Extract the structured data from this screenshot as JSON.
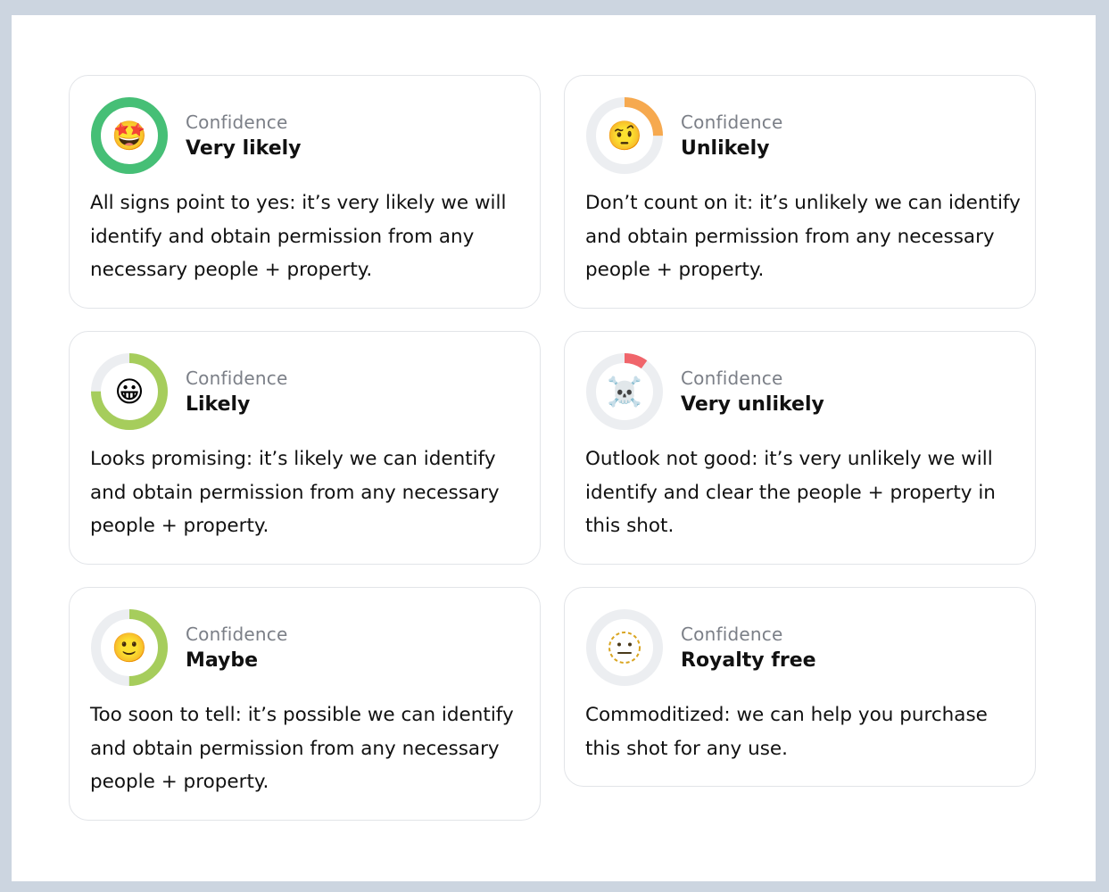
{
  "cards": [
    {
      "label": "Confidence",
      "title": "Very likely",
      "description": "All signs point to yes: it’s very likely we will identify and obtain permission from any necessary people + property.",
      "emoji": "🤩",
      "emoji_name": "star-struck-face-icon",
      "ring_fraction": 1.0,
      "ring_color": "#46bf76"
    },
    {
      "label": "Confidence",
      "title": "Unlikely",
      "description": "Don’t count on it: it’s unlikely we can identify and obtain permission from any necessary people + property.",
      "emoji": "🤨",
      "emoji_name": "raised-eyebrow-face-icon",
      "ring_fraction": 0.25,
      "ring_color": "#f6a94f"
    },
    {
      "label": "Confidence",
      "title": "Likely",
      "description": "Looks promising: it’s likely we can identify and obtain permission from any necessary people + property.",
      "emoji": "😀",
      "emoji_name": "grinning-face-icon",
      "ring_fraction": 0.75,
      "ring_color": "#a6cd5c"
    },
    {
      "label": "Confidence",
      "title": "Very unlikely",
      "description": "Outlook not good: it’s very unlikely we will identify and clear the people + property in this shot.",
      "emoji": "☠️",
      "emoji_name": "skull-and-crossbones-icon",
      "ring_fraction": 0.1,
      "ring_color": "#f0656b"
    },
    {
      "label": "Confidence",
      "title": "Maybe",
      "description": "Too soon to tell: it’s possible we can identify and obtain permission from any necessary people + property.",
      "emoji": "🙂",
      "emoji_name": "slightly-smiling-face-icon",
      "ring_fraction": 0.5,
      "ring_color": "#a6cd5c"
    },
    {
      "label": "Confidence",
      "title": "Royalty free",
      "description": "Commoditized: we can help you purchase this shot for any use.",
      "emoji": "",
      "emoji_name": "dotted-line-face-icon",
      "ring_fraction": 0,
      "ring_color": "#eceef1"
    }
  ],
  "colors": {
    "page_bg": "#ccd5e0",
    "card_border": "#e2e4e8",
    "ring_track": "#eceef1",
    "label": "#7b7f87",
    "text": "#111111"
  }
}
